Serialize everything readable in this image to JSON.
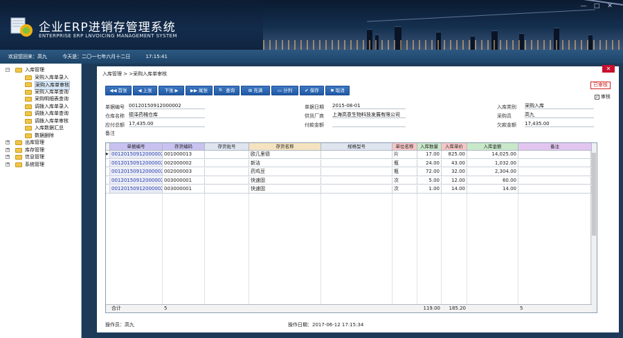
{
  "app": {
    "title_cn": "企业ERP进销存管理系统",
    "title_en": "ENTERPRISE ERP LNVOICING MANAGEMENT SYSTEM",
    "window_controls": [
      "—",
      "□",
      "✕"
    ]
  },
  "status": {
    "welcome": "欢迎您回来：高九",
    "today": "今天是：二〇一七年六月十二日",
    "time": "17:15:41"
  },
  "sidebar": [
    {
      "label": "入库管理",
      "level": 0,
      "expanded": true
    },
    {
      "label": "采购入库单录入",
      "level": 1
    },
    {
      "label": "采购入库单审核",
      "level": 1,
      "selected": true
    },
    {
      "label": "采购入库单查询",
      "level": 1
    },
    {
      "label": "采购明细表查询",
      "level": 1
    },
    {
      "label": "调拨入库单录入",
      "level": 1
    },
    {
      "label": "调拨入库单查询",
      "level": 1
    },
    {
      "label": "调拨入库单审核",
      "level": 1
    },
    {
      "label": "入库数据汇总",
      "level": 1
    },
    {
      "label": "数据删除",
      "level": 1
    },
    {
      "label": "出库管理",
      "level": 0
    },
    {
      "label": "库存管理",
      "level": 0
    },
    {
      "label": "信息管理",
      "level": 0
    },
    {
      "label": "系统管理",
      "level": 0
    }
  ],
  "breadcrumb": "入库管理 > >采购入库单审核",
  "toolbar": [
    {
      "label": "◀◀ 首张",
      "icon": "first-icon"
    },
    {
      "label": "◀ 上张",
      "icon": "prev-icon"
    },
    {
      "label": "下张 ▶",
      "icon": "next-icon"
    },
    {
      "label": "▶▶ 尾张",
      "icon": "last-icon"
    },
    {
      "label": "🔍 查询",
      "icon": "search-icon"
    },
    {
      "label": "⊞ 充满",
      "icon": "fill-icon"
    },
    {
      "label": "▭ 分列",
      "icon": "columns-icon"
    },
    {
      "label": "✔ 保存",
      "icon": "save-icon"
    },
    {
      "label": "✖ 取消",
      "icon": "cancel-icon"
    }
  ],
  "audit_badge": "已审核",
  "audit_check": {
    "label": "审核",
    "checked": true
  },
  "form": {
    "doc_no_label": "单据编号",
    "doc_no": "00120150912000002",
    "doc_date_label": "单据日期",
    "doc_date": "2015-08-01",
    "in_type_label": "入库类别",
    "in_type": "采购入库",
    "warehouse_label": "仓库名称",
    "warehouse": "德泽药械仓库",
    "supplier_label": "供货厂商",
    "supplier": "上海高意生物科技发展有限公司",
    "buyer_label": "采购员",
    "buyer": "高九",
    "payable_label": "应付总额",
    "payable": "17,435.00",
    "paid_label": "付款金额",
    "paid": "",
    "owed_label": "欠款金额",
    "owed": "17,435.00",
    "note_label": "备注",
    "note": ""
  },
  "grid": {
    "headers": [
      "单据编号",
      "存货编码",
      "存货批号",
      "存货名称",
      "规格型号",
      "单位名称",
      "入库数量",
      "入库单价",
      "入库金额",
      "备注"
    ],
    "header_colors": [
      "#c9c2f0",
      "#c9c2f0",
      "#dfe5ef",
      "#f5e3c0",
      "#dfe5ef",
      "#f5c6c6",
      "#c9e8c9",
      "#f5c6c6",
      "#c9e8c9",
      "#e2c6f0"
    ],
    "rows": [
      [
        "00120150912000002",
        "001000013",
        "",
        "欧几里德",
        "",
        "片",
        "17.00",
        "825.00",
        "14,025.00",
        ""
      ],
      [
        "00120150912000002",
        "002000002",
        "",
        "新洁",
        "",
        "瓶",
        "24.00",
        "43.00",
        "1,032.00",
        ""
      ],
      [
        "00120150912000002",
        "002000003",
        "",
        "药鸡豆",
        "",
        "瓶",
        "72.00",
        "32.00",
        "2,304.00",
        ""
      ],
      [
        "00120150912000002",
        "003000001",
        "",
        "快速固",
        "",
        "次",
        "5.00",
        "12.00",
        "60.00",
        ""
      ],
      [
        "00120150912000002",
        "003000001",
        "",
        "快速固",
        "",
        "次",
        "1.00",
        "14.00",
        "14.00",
        ""
      ]
    ],
    "totals": {
      "label": "合计",
      "count": "5",
      "qty": "119.00",
      "price": "185.20",
      "count2": "5"
    }
  },
  "footer": {
    "operator": "操作员：高九",
    "op_date": "操作日期：2017-06-12 17:15:34"
  }
}
